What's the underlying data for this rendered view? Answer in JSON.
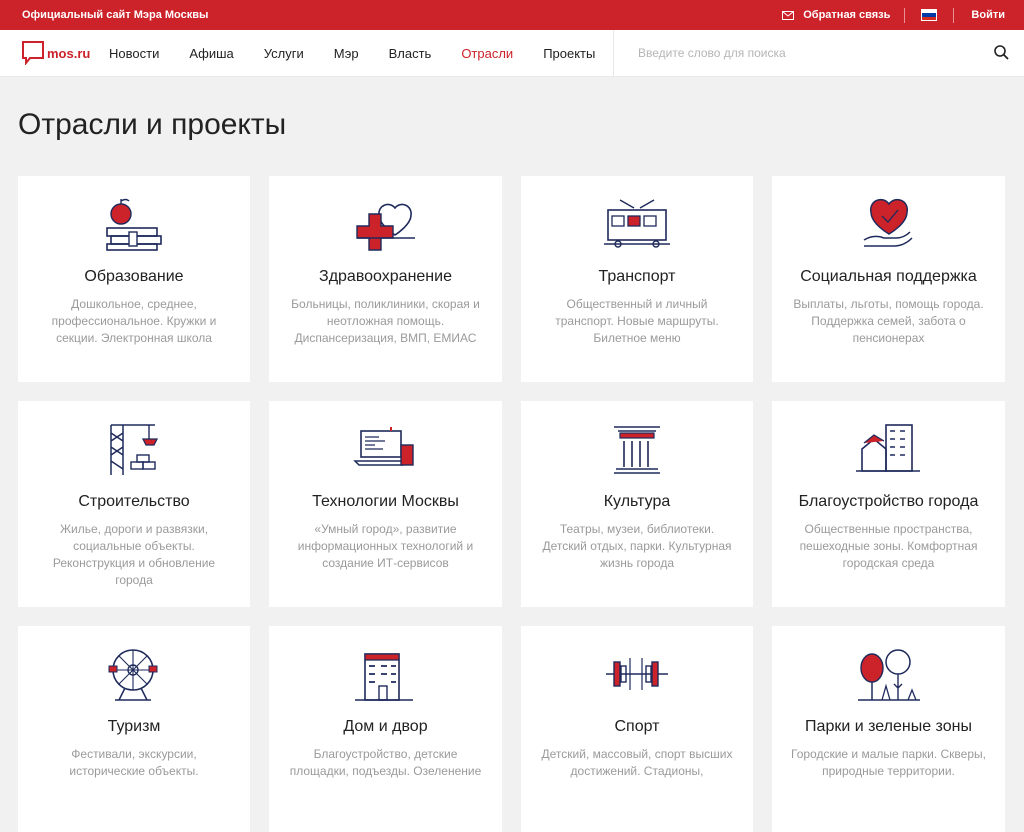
{
  "topbar": {
    "site_title": "Официальный сайт Мэра Москвы",
    "feedback_label": "Обратная связь",
    "login_label": "Войти"
  },
  "header": {
    "logo_text": "mos.ru",
    "nav": [
      "Новости",
      "Афиша",
      "Услуги",
      "Мэр",
      "Власть",
      "Отрасли",
      "Проекты"
    ],
    "active_nav": "Отрасли",
    "search_placeholder": "Введите слово для поиска"
  },
  "page": {
    "title": "Отрасли и проекты"
  },
  "cards": [
    {
      "title": "Образование",
      "description": "Дошкольное, среднее, профессиональное. Кружки и секции. Электронная школа",
      "icon": "education-icon"
    },
    {
      "title": "Здравоохранение",
      "description": "Больницы, поликлиники, скорая и неотложная помощь. Диспансеризация, ВМП, ЕМИАС",
      "icon": "health-icon"
    },
    {
      "title": "Транспорт",
      "description": "Общественный и личный транспорт. Новые маршруты. Билетное меню",
      "icon": "transport-icon"
    },
    {
      "title": "Социальная поддержка",
      "description": "Выплаты, льготы, помощь города. Поддержка семей, забота о пенсионерах",
      "icon": "social-support-icon"
    },
    {
      "title": "Строительство",
      "description": "Жилье, дороги и развязки, социальные объекты. Реконструкция и обновление города",
      "icon": "construction-icon"
    },
    {
      "title": "Технологии Москвы",
      "description": "«Умный город», развитие информационных технологий и создание ИТ-сервисов",
      "icon": "technology-icon"
    },
    {
      "title": "Культура",
      "description": "Театры, музеи, библиотеки. Детский отдых, парки. Культурная жизнь города",
      "icon": "culture-icon"
    },
    {
      "title": "Благоустройство города",
      "description": "Общественные пространства, пешеходные зоны. Комфортная городская среда",
      "icon": "urban-improvement-icon"
    },
    {
      "title": "Туризм",
      "description": "Фестивали, экскурсии, исторические объекты.",
      "icon": "tourism-icon"
    },
    {
      "title": "Дом и двор",
      "description": "Благоустройство, детские площадки, подъезды. Озеленение",
      "icon": "house-yard-icon"
    },
    {
      "title": "Спорт",
      "description": "Детский, массовый, спорт высших достижений. Стадионы,",
      "icon": "sport-icon"
    },
    {
      "title": "Парки и зеленые зоны",
      "description": "Городские и малые парки. Скверы, природные территории.",
      "icon": "parks-icon"
    }
  ],
  "colors": {
    "accent": "#cc2229",
    "icon_stroke": "#1f2a5c",
    "page_bg": "#f1f1f1"
  }
}
